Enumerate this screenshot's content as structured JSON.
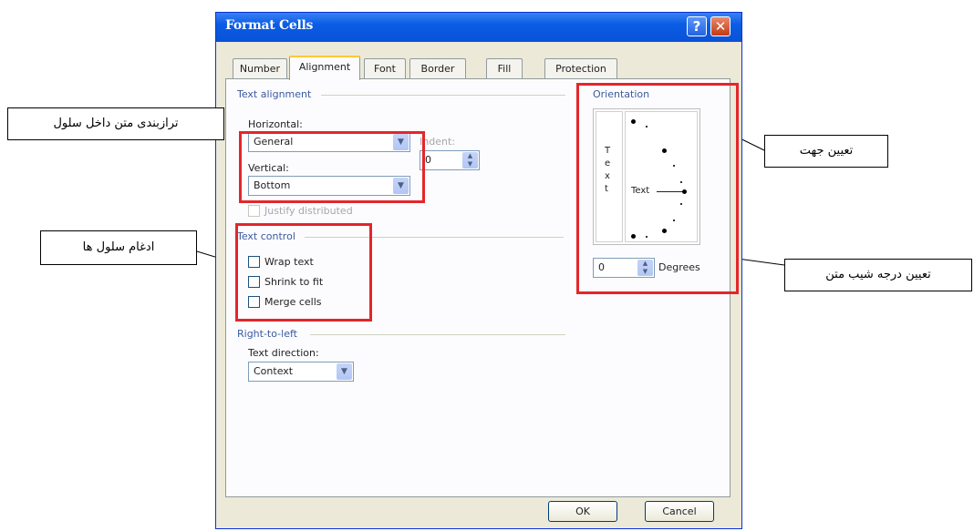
{
  "dialog": {
    "title": "Format Cells",
    "help_icon": "?",
    "close_icon": "✕",
    "tabs": [
      "Number",
      "Alignment",
      "Font",
      "Border",
      "Fill",
      "Protection"
    ],
    "active_tab": "Alignment"
  },
  "text_alignment": {
    "group_label": "Text alignment",
    "horizontal_label": "Horizontal:",
    "horizontal_value": "General",
    "vertical_label": "Vertical:",
    "vertical_value": "Bottom",
    "indent_label": "Indent:",
    "indent_value": "0",
    "justify_distributed_label": "Justify distributed"
  },
  "text_control": {
    "group_label": "Text control",
    "wrap_text": "Wrap text",
    "shrink_to_fit": "Shrink to fit",
    "merge_cells": "Merge cells"
  },
  "right_to_left": {
    "group_label": "Right-to-left",
    "direction_label": "Text direction:",
    "direction_value": "Context"
  },
  "orientation": {
    "group_label": "Orientation",
    "vertical_text": "T e x t",
    "text_label": "Text",
    "degrees_value": "0",
    "degrees_label": "Degrees"
  },
  "buttons": {
    "ok": "OK",
    "cancel": "Cancel"
  },
  "annotations": {
    "cell_text_alignment": "ترازبندی متن داخل سلول",
    "merge_cells": "ادغام سلول ها",
    "set_direction": "تعیین جهت",
    "set_text_angle": "تعیین درجه شیب متن"
  },
  "colors": {
    "highlight_box": "#e3262b",
    "title_bar": "#0a5ce5",
    "dialog_bg": "#ece9d8"
  }
}
